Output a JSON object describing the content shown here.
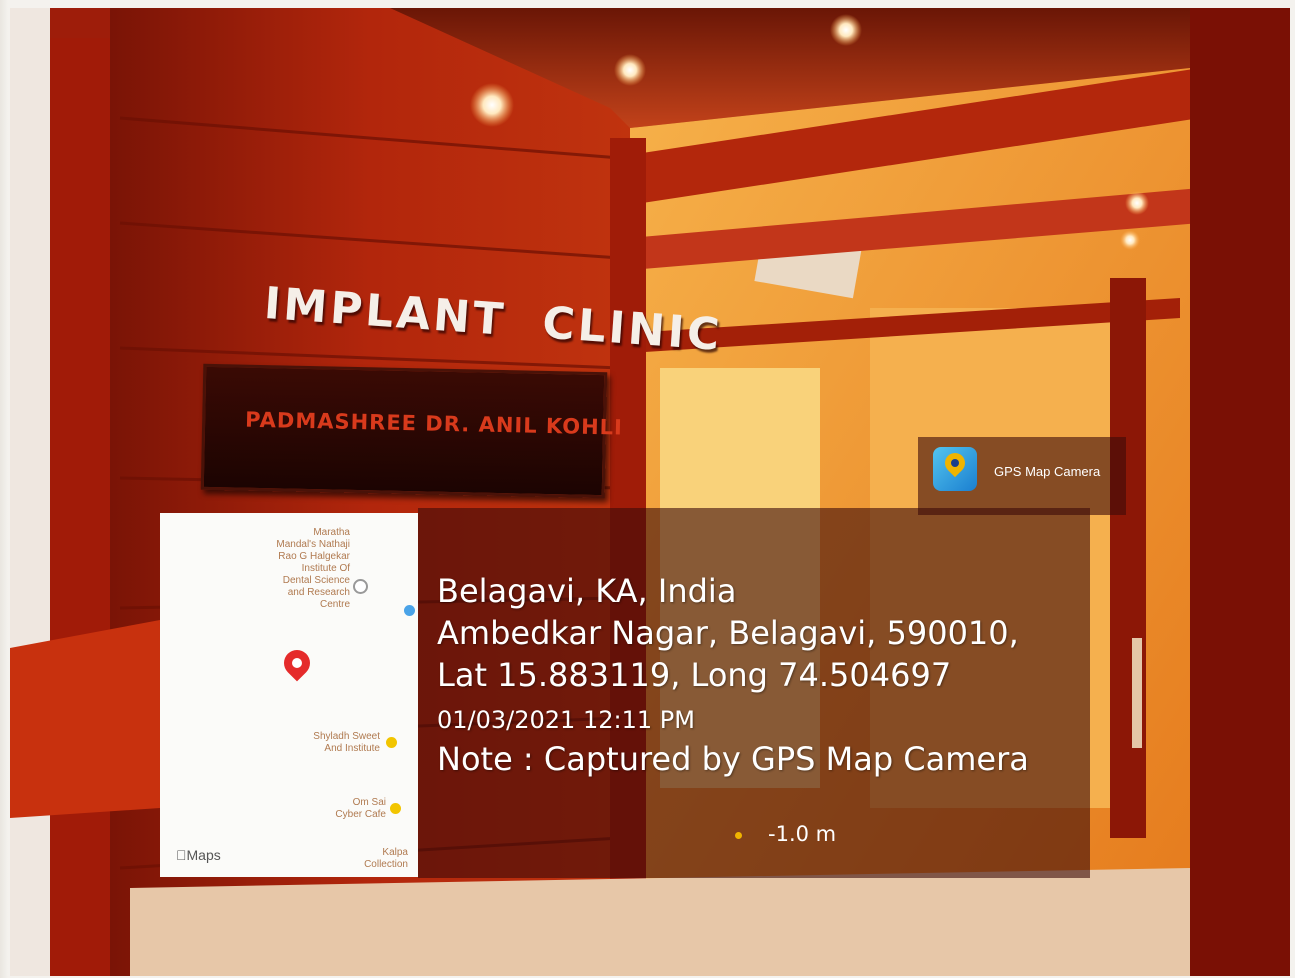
{
  "photo": {
    "sign_title_word1": "IMPLANT",
    "sign_title_word2": "CLINIC",
    "plaque_text": "PADMASHREE DR. ANIL KOHLI"
  },
  "app_badge": {
    "icon": "gps-map-camera-icon",
    "name": "GPS Map Camera"
  },
  "map": {
    "labels": [
      "Maratha\nMandal's Nathaji\nRao G Halgekar\nInstitute Of\nDental Science\nand Research\nCentre",
      "Shyladh Sweet\nAnd Institute",
      "Om Sai\nCyber Cafe",
      "Kalpa\nCollection"
    ],
    "brand": "Maps",
    "pin_icon": "location-pin-icon"
  },
  "location": {
    "city": "Belagavi, KA, India",
    "address": "Ambedkar Nagar, Belagavi, 590010,",
    "coords": "Lat 15.883119, Long 74.504697",
    "datetime": "01/03/2021 12:11 PM",
    "note": "Note : Captured by GPS Map Camera",
    "altitude": "-1.0 m"
  },
  "colors": {
    "wall": "#9e1d0a",
    "overlay": "#3c0a08",
    "pin": "#e52b2b",
    "accent": "#f0b400"
  }
}
